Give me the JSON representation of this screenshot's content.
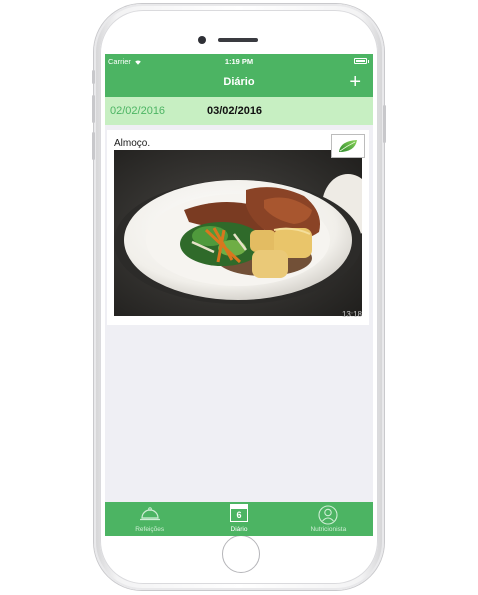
{
  "status_bar": {
    "carrier": "Carrier",
    "time": "1:19 PM"
  },
  "nav": {
    "title": "Diário",
    "add_symbol": "+"
  },
  "dates": {
    "previous": "02/02/2016",
    "current": "03/02/2016"
  },
  "meal": {
    "title": "Almoço.",
    "time": "13:18",
    "badge_icon": "leaf-icon"
  },
  "tabs": [
    {
      "label": "Refeições",
      "icon": "cloche-icon",
      "active": false
    },
    {
      "label": "Diário",
      "icon": "calendar-icon",
      "calendar_day": "6",
      "active": true
    },
    {
      "label": "Nutricionista",
      "icon": "person-icon",
      "active": false
    }
  ],
  "colors": {
    "primary": "#4cb463",
    "date_bar": "#c7efc2",
    "background": "#efeff4"
  }
}
